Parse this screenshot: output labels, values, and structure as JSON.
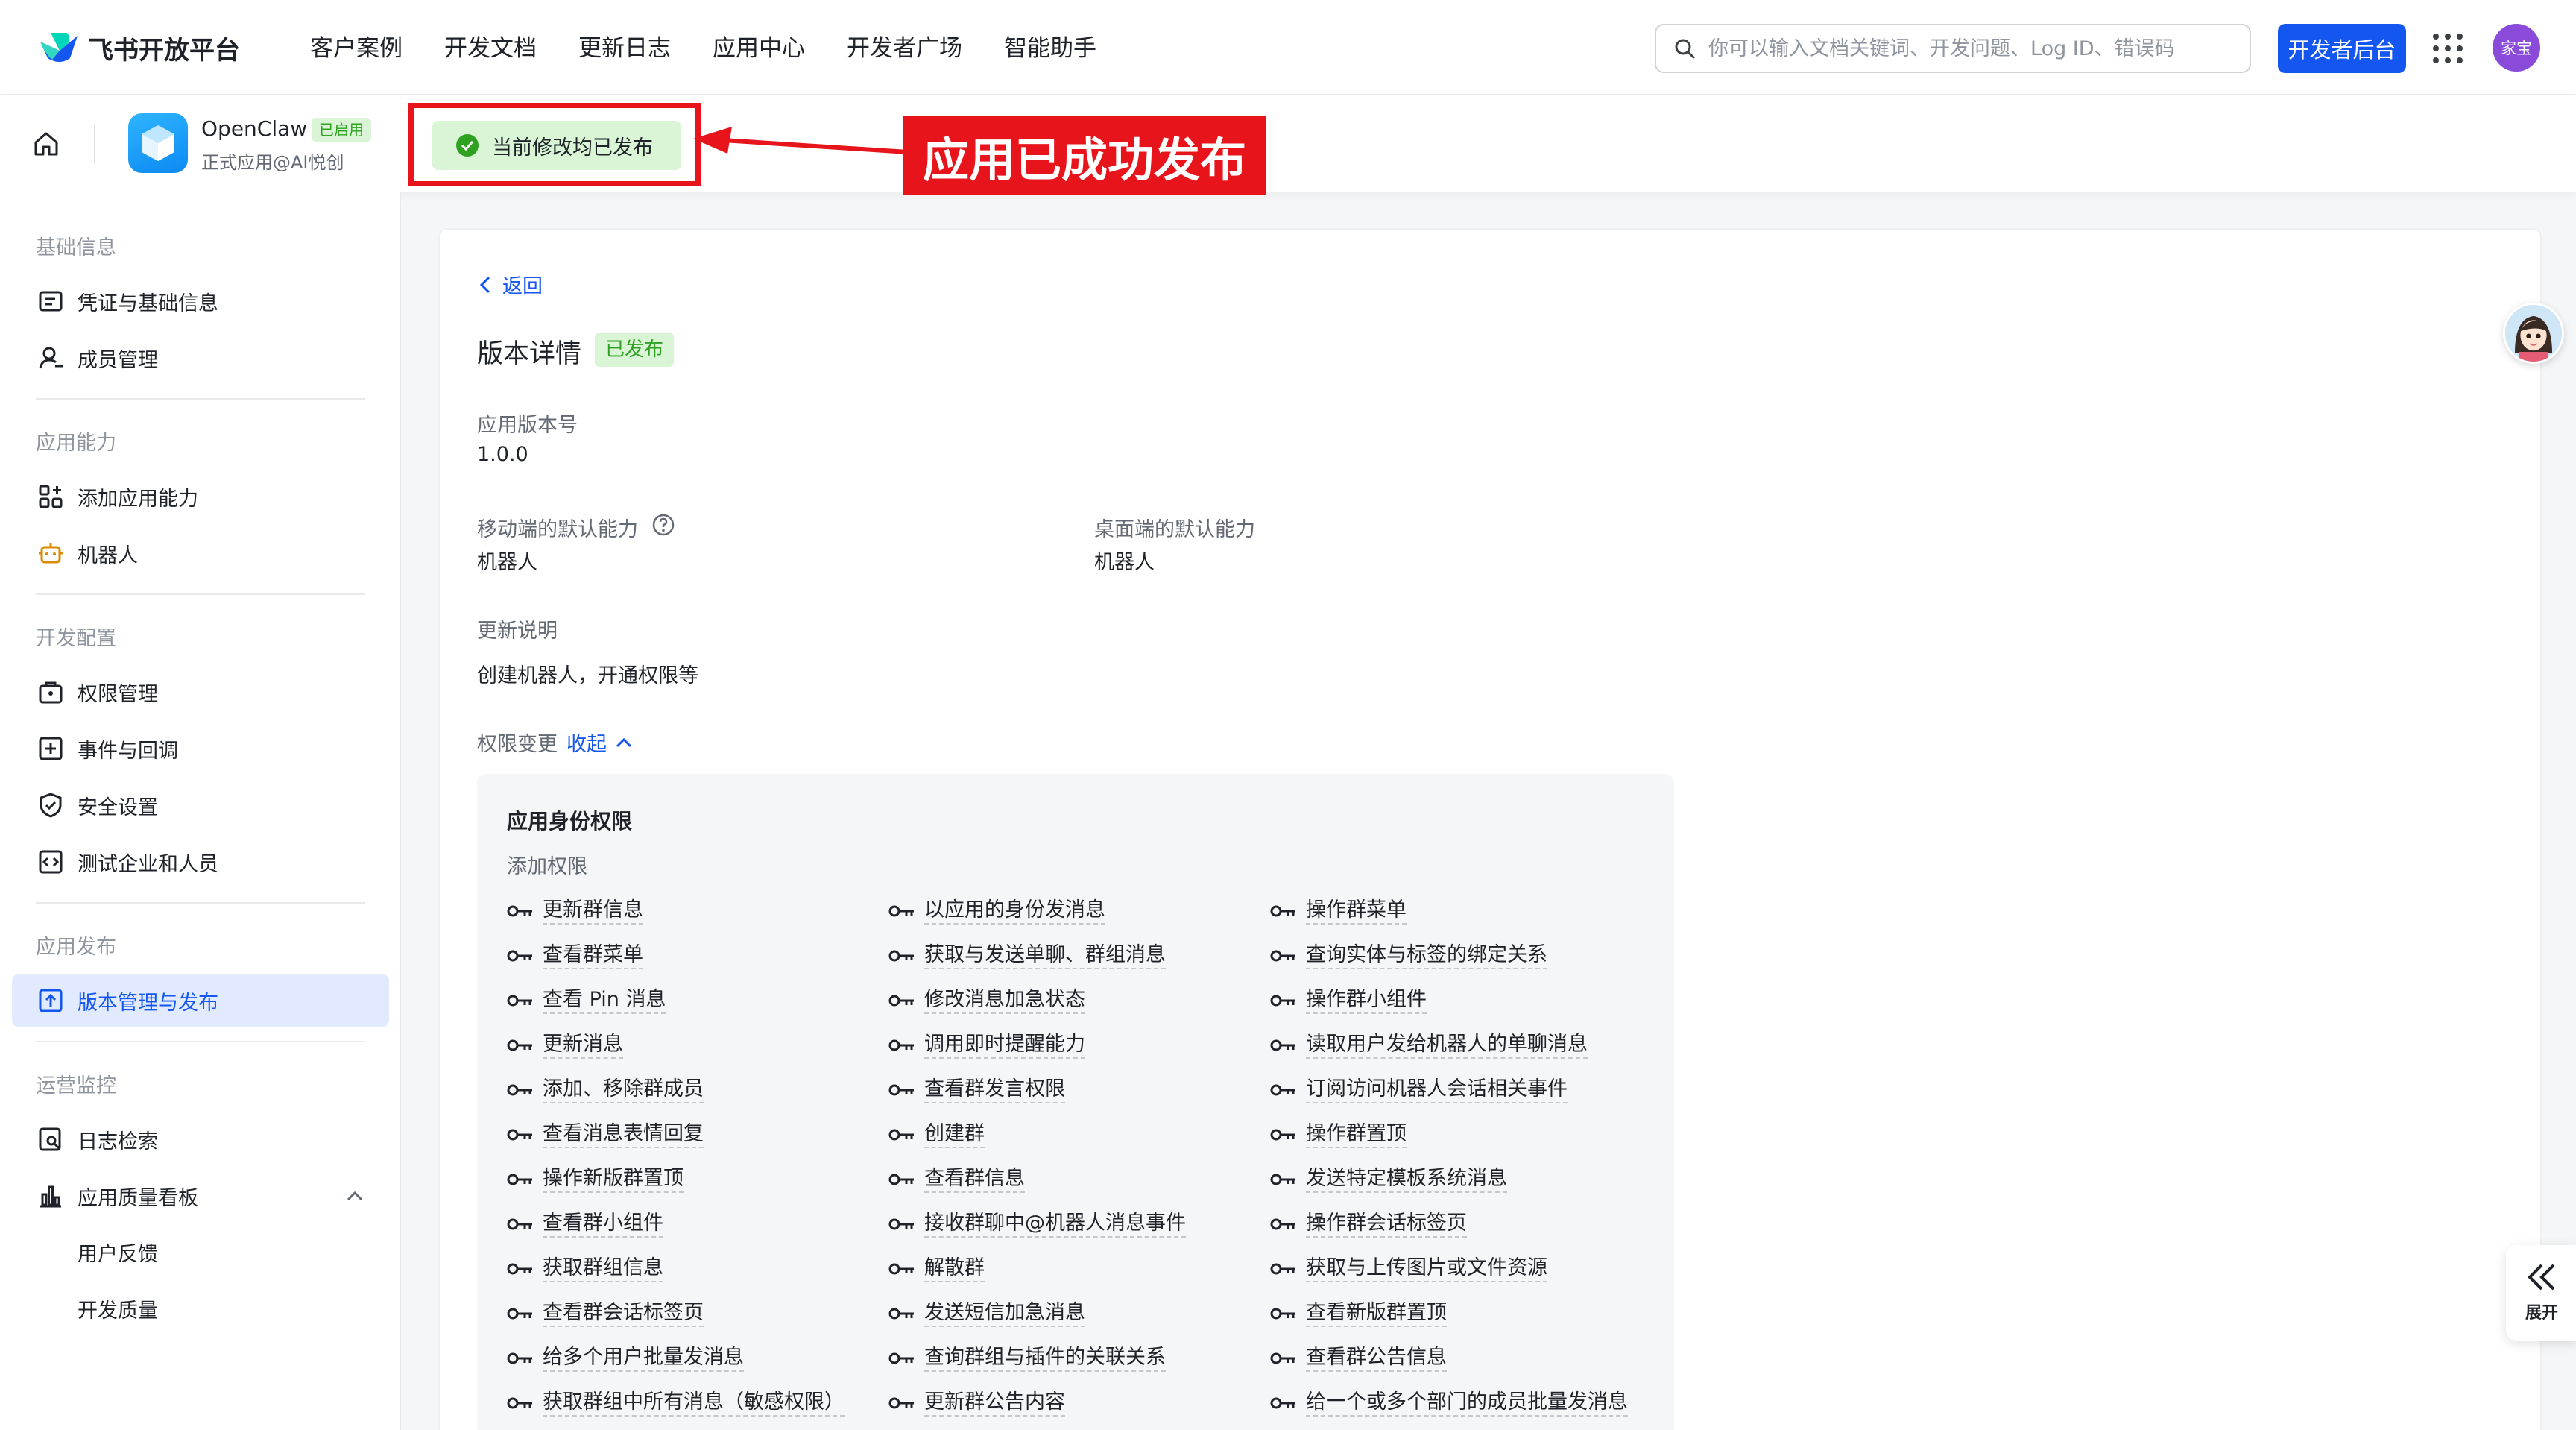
{
  "topnav": {
    "logo_text": "飞书开放平台",
    "links": [
      "客户案例",
      "开发文档",
      "更新日志",
      "应用中心",
      "开发者广场",
      "智能助手"
    ],
    "search_placeholder": "你可以输入文档关键词、开发问题、Log ID、错误码",
    "dev_button": "开发者后台",
    "avatar_text": "家宝"
  },
  "app": {
    "name": "OpenClaw",
    "badge": "已启用",
    "subtitle": "正式应用@AI悦创",
    "status": "当前修改均已发布",
    "annotation": "应用已成功发布"
  },
  "sidebar": {
    "sections": [
      {
        "title": "基础信息",
        "items": [
          {
            "label": "凭证与基础信息",
            "icon": "credential-icon"
          },
          {
            "label": "成员管理",
            "icon": "member-icon"
          }
        ]
      },
      {
        "title": "应用能力",
        "items": [
          {
            "label": "添加应用能力",
            "icon": "apps-icon"
          },
          {
            "label": "机器人",
            "icon": "robot-icon"
          }
        ]
      },
      {
        "title": "开发配置",
        "items": [
          {
            "label": "权限管理",
            "icon": "permission-icon"
          },
          {
            "label": "事件与回调",
            "icon": "event-icon"
          },
          {
            "label": "安全设置",
            "icon": "shield-icon"
          },
          {
            "label": "测试企业和人员",
            "icon": "code-icon"
          }
        ]
      },
      {
        "title": "应用发布",
        "items": [
          {
            "label": "版本管理与发布",
            "icon": "publish-icon"
          }
        ]
      },
      {
        "title": "运营监控",
        "items": [
          {
            "label": "日志检索",
            "icon": "log-search-icon"
          },
          {
            "label": "应用质量看板",
            "icon": "chart-icon"
          }
        ]
      }
    ],
    "sub_items": [
      "用户反馈",
      "开发质量"
    ],
    "active": "版本管理与发布"
  },
  "detail": {
    "back": "返回",
    "title": "版本详情",
    "tag": "已发布",
    "version_label": "应用版本号",
    "version_value": "1.0.0",
    "mobile_label": "移动端的默认能力",
    "mobile_value": "机器人",
    "desktop_label": "桌面端的默认能力",
    "desktop_value": "机器人",
    "notes_label": "更新说明",
    "notes_value": "创建机器人，开通权限等",
    "perm_change_label": "权限变更",
    "perm_toggle": "收起"
  },
  "permissions": {
    "heading": "应用身份权限",
    "subheading": "添加权限",
    "col1": [
      "更新群信息",
      "查看群菜单",
      "查看 Pin 消息",
      "更新消息",
      "添加、移除群成员",
      "查看消息表情回复",
      "操作新版群置顶",
      "查看群小组件",
      "获取群组信息",
      "查看群会话标签页",
      "给多个用户批量发消息",
      "获取群组中所有消息（敏感权限）"
    ],
    "col2": [
      "以应用的身份发消息",
      "获取与发送单聊、群组消息",
      "修改消息加急状态",
      "调用即时提醒能力",
      "查看群发言权限",
      "创建群",
      "查看群信息",
      "接收群聊中@机器人消息事件",
      "解散群",
      "发送短信加急消息",
      "查询群组与插件的关联关系",
      "更新群公告内容"
    ],
    "col3": [
      "操作群菜单",
      "查询实体与标签的绑定关系",
      "操作群小组件",
      "读取用户发给机器人的单聊消息",
      "订阅访问机器人会话相关事件",
      "操作群置顶",
      "发送特定模板系统消息",
      "操作群会话标签页",
      "获取与上传图片或文件资源",
      "查看新版群置顶",
      "查看群公告信息",
      "给一个或多个部门的成员批量发消息"
    ]
  },
  "floating": {
    "expand_label": "展开"
  },
  "colors": {
    "primary": "#1456f0",
    "success": "#2ea121",
    "annotation_red": "#e8141c"
  }
}
